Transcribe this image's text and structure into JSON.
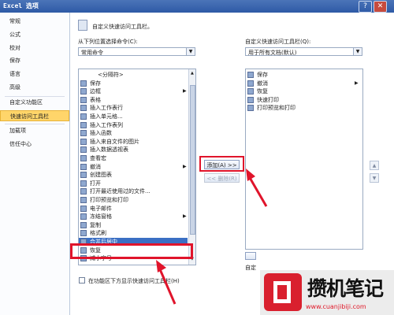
{
  "window": {
    "title": "Excel 选项",
    "help_glyph": "?",
    "close_glyph": "✕"
  },
  "sidebar": {
    "items": [
      {
        "label": "常规"
      },
      {
        "label": "公式"
      },
      {
        "label": "校对"
      },
      {
        "label": "保存"
      },
      {
        "label": "语言"
      },
      {
        "label": "高级"
      },
      {
        "label": "自定义功能区"
      },
      {
        "label": "快速访问工具栏",
        "selected": true
      },
      {
        "label": "加载项"
      },
      {
        "label": "信任中心"
      }
    ]
  },
  "main": {
    "heading": "自定义快速访问工具栏。",
    "left": {
      "label": "从下列位置选择命令(C):",
      "combo_value": "常用命令",
      "commands": [
        {
          "label": "<分隔符>",
          "icon": "separator-icon"
        },
        {
          "label": "保存",
          "icon": "save-icon"
        },
        {
          "label": "边框",
          "icon": "border-icon",
          "submenu": true
        },
        {
          "label": "表格",
          "icon": "table-icon"
        },
        {
          "label": "插入工作表行",
          "icon": "insert-row-icon"
        },
        {
          "label": "插入单元格...",
          "icon": "insert-cells-icon"
        },
        {
          "label": "插入工作表列",
          "icon": "insert-column-icon"
        },
        {
          "label": "插入函数",
          "icon": "function-icon"
        },
        {
          "label": "插入来自文件的图片",
          "icon": "picture-icon"
        },
        {
          "label": "插入数据透视表",
          "icon": "pivot-table-icon"
        },
        {
          "label": "查看宏",
          "icon": "macro-icon"
        },
        {
          "label": "撤消",
          "icon": "undo-icon",
          "submenu": true
        },
        {
          "label": "创建图表",
          "icon": "chart-icon"
        },
        {
          "label": "打开",
          "icon": "open-icon"
        },
        {
          "label": "打开最近使用过的文件...",
          "icon": "recent-file-icon"
        },
        {
          "label": "打印预览和打印",
          "icon": "print-preview-icon"
        },
        {
          "label": "电子邮件",
          "icon": "email-icon"
        },
        {
          "label": "冻结窗格",
          "icon": "freeze-panes-icon",
          "submenu": true
        },
        {
          "label": "复制",
          "icon": "copy-icon"
        },
        {
          "label": "格式刷",
          "icon": "format-painter-icon"
        },
        {
          "label": "合并后居中",
          "icon": "merge-center-icon",
          "selected": true
        },
        {
          "label": "恢复",
          "icon": "redo-icon"
        },
        {
          "label": "减小字号",
          "icon": "decrease-font-icon"
        }
      ],
      "show_below_label": "在功能区下方显示快速访问工具栏(H)"
    },
    "right": {
      "label": "自定义快速访问工具栏(Q):",
      "combo_value": "用于所有文档(默认)",
      "items": [
        {
          "label": "保存",
          "icon": "save-icon"
        },
        {
          "label": "撤消",
          "icon": "undo-icon",
          "submenu": true
        },
        {
          "label": "恢复",
          "icon": "redo-icon"
        },
        {
          "label": "快速打印",
          "icon": "quick-print-icon"
        },
        {
          "label": "打印预览和打印",
          "icon": "print-preview-icon"
        }
      ],
      "bottom_label_fragment": "自定"
    },
    "add_button": "添加(A) >>",
    "remove_button": "<< 删除(R)",
    "move_up_glyph": "▲",
    "move_down_glyph": "▼"
  },
  "watermark": {
    "text": "攒机笔记",
    "url": "www.cuanjibiji.com"
  },
  "colors": {
    "highlight_red": "#e0142b",
    "selection_blue": "#3b6fc4",
    "sidebar_selected": "#ffd56a"
  }
}
